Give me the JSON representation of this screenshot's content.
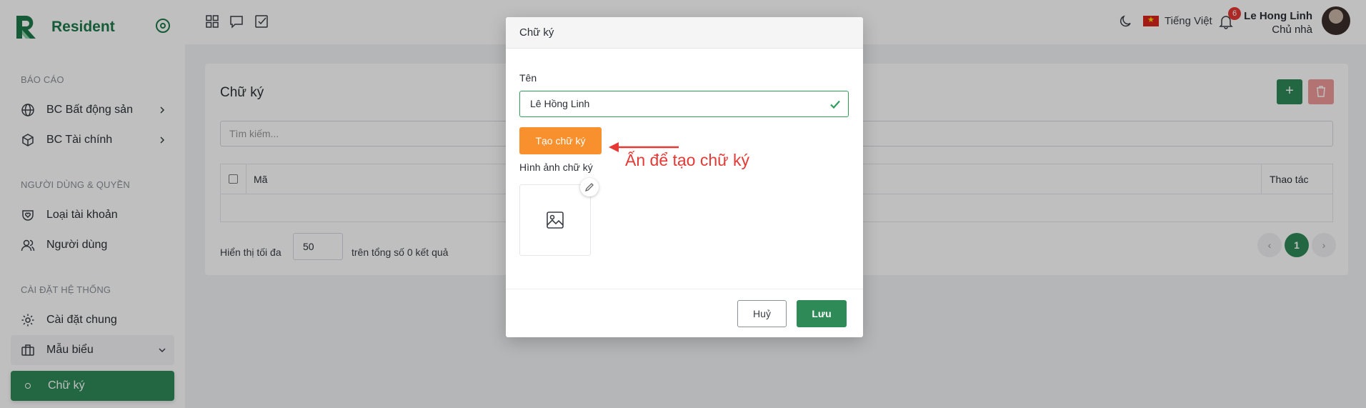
{
  "app": {
    "name": "Resident"
  },
  "sidebar": {
    "sections": [
      {
        "title": "BÁO CÁO"
      },
      {
        "title": "NGƯỜI DÙNG & QUYỀN"
      },
      {
        "title": "CÀI ĐẶT HỆ THỐNG"
      }
    ],
    "items": [
      {
        "label": "BC Bất động sản",
        "icon": "globe-icon"
      },
      {
        "label": "BC Tài chính",
        "icon": "cube-icon"
      },
      {
        "label": "Loại tài khoản",
        "icon": "shield-heart-icon"
      },
      {
        "label": "Người dùng",
        "icon": "users-icon"
      },
      {
        "label": "Cài đặt chung",
        "icon": "gear-icon"
      },
      {
        "label": "Mẫu biểu",
        "icon": "briefcase-icon"
      },
      {
        "label": "Chữ ký",
        "icon": "circle-dot-icon"
      }
    ]
  },
  "header": {
    "language": "Tiếng Việt",
    "notification_count": "6",
    "user": {
      "name": "Le Hong Linh",
      "role": "Chủ nhà"
    }
  },
  "main": {
    "title": "Chữ ký",
    "search": {
      "placeholder": "Tìm kiếm..."
    },
    "table": {
      "columns": [
        "Mã",
        "Thao tác"
      ]
    },
    "pagination": {
      "show_label": "Hiển thị tối đa",
      "page_size": "50",
      "total_label": "trên tổng số 0 kết quả",
      "current_page": "1",
      "prev": "‹",
      "next": "›"
    }
  },
  "modal": {
    "title": "Chữ ký",
    "name_label": "Tên",
    "name_value": "Lê Hồng Linh",
    "create_button": "Tạo chữ ký",
    "image_label": "Hình ảnh chữ ký",
    "cancel_button": "Huỷ",
    "save_button": "Lưu"
  },
  "annotation": {
    "text": "Ấn để tạo chữ ký"
  },
  "colors": {
    "brand_green": "#2e8a57",
    "accent_orange": "#f7902d",
    "annotation_red": "#e53935"
  }
}
